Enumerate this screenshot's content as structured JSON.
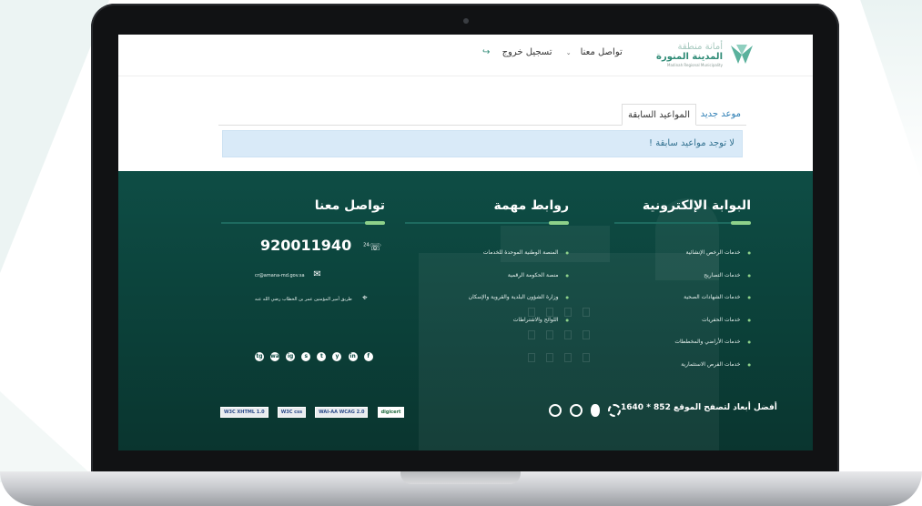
{
  "header": {
    "logo_line1": "أمانة منطقة",
    "logo_line2": "المدينة المنورة",
    "logo_line3": "Madinah Regional Municipality",
    "nav_contact": "تواصل معنا",
    "nav_logout": "تسجيل خروج"
  },
  "tabs": {
    "new_appointment": "موعد جديد",
    "previous_appointments": "المواعيد السابقة"
  },
  "alert": {
    "message": "لا توجد مواعيد سابقة !"
  },
  "footer": {
    "portal": {
      "title": "البوابة الإلكترونية",
      "items": [
        "خدمات الرخص الإنشائية",
        "خدمات التصاريح",
        "خدمات الشهادات الصحية",
        "خدمات الحفريات",
        "خدمات الأراضي والمخططات",
        "خدمات الفرص الاستثمارية"
      ]
    },
    "links": {
      "title": "روابط مهمة",
      "items": [
        "المنصة الوطنية الموحدة للخدمات",
        "منصة الحكومة الرقمية",
        "وزارة الشؤون البلدية والقروية والإسكان",
        "اللوائح والاشتراطات"
      ]
    },
    "contact": {
      "title": "تواصل معنا",
      "phone": "920011940",
      "phone_badge": "24",
      "email": "cr@amana-md.gov.sa",
      "address": "طريق أمير المؤمنين عمر بن الخطاب رضي الله عنه"
    },
    "socials": [
      "f",
      "in",
      "y",
      "t",
      "s",
      "ig",
      "wa",
      "tg"
    ],
    "screen_size": "أفضل أبعاد لتصفح الموقع 852 * 1640",
    "badges": [
      "digicert",
      "WAI-AA WCAG 2.0",
      "W3C css",
      "W3C XHTML 1.0"
    ]
  }
}
